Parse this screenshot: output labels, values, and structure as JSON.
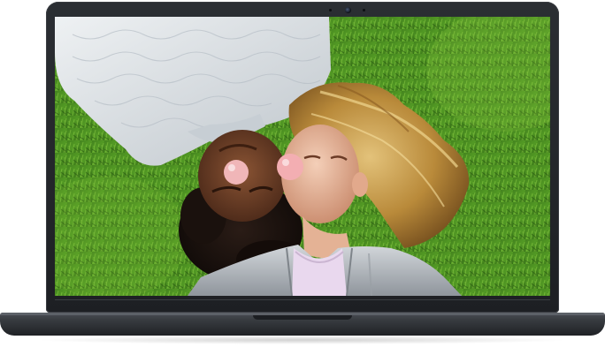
{
  "scene": {
    "subject": "laptop-product-photo",
    "screen_content": "two-people-lying-on-grass",
    "colors": {
      "laptop_body": "#23262a",
      "laptop_base": "#393c41",
      "grass_dark": "#1f4f12",
      "grass_light": "#6fb82c",
      "sweater": "#dfe3e6",
      "jacket": "#b9bec4",
      "hair_blonde": "#c9a14a",
      "hair_dark": "#1a1210",
      "skin_light": "#e7b79c",
      "skin_dark": "#6a3d26",
      "bubble_pink": "#f2b4b4"
    }
  }
}
